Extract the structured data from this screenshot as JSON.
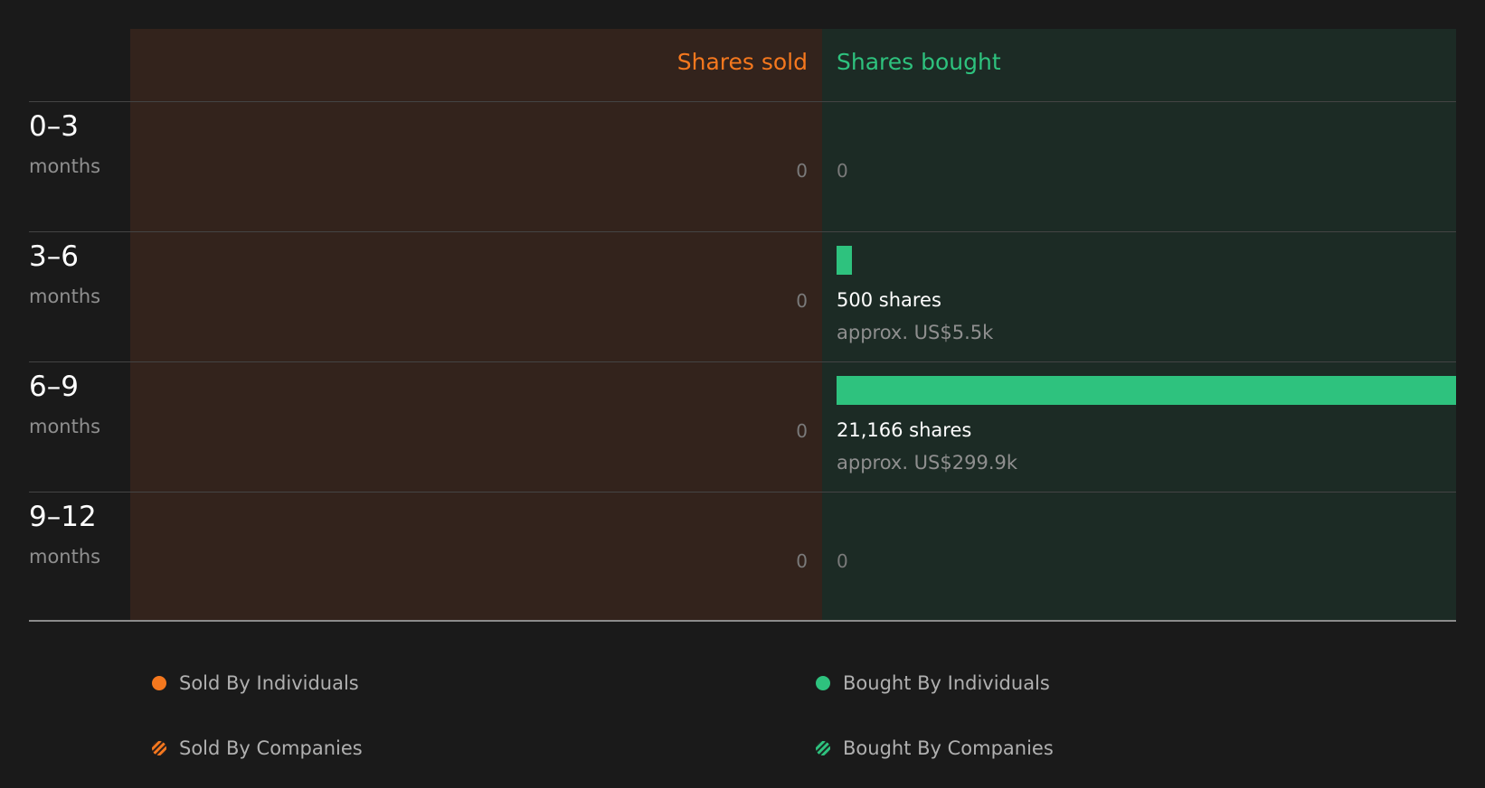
{
  "colors": {
    "sold": "#f5781e",
    "bought": "#2ec27e",
    "sold_panel": "#33231c",
    "bought_panel": "#1c2b25",
    "background": "#1a1a1a"
  },
  "headers": {
    "sold": "Shares sold",
    "bought": "Shares bought"
  },
  "chart_data": {
    "type": "bar",
    "categories": [
      "0–3 months",
      "3–6 months",
      "6–9 months",
      "9–12 months"
    ],
    "series": [
      {
        "name": "Shares sold",
        "values": [
          0,
          0,
          0,
          0
        ]
      },
      {
        "name": "Shares bought",
        "values": [
          0,
          500,
          21166,
          0
        ]
      }
    ],
    "max_value": 21166
  },
  "rows": [
    {
      "period": "0–3",
      "unit": "months",
      "sold_text": "0",
      "bought_zero_text": "0",
      "bought_shares": 0,
      "bought_shares_text": "",
      "bought_approx_text": ""
    },
    {
      "period": "3–6",
      "unit": "months",
      "sold_text": "0",
      "bought_zero_text": "",
      "bought_shares": 500,
      "bought_shares_text": "500 shares",
      "bought_approx_text": "approx. US$5.5k"
    },
    {
      "period": "6–9",
      "unit": "months",
      "sold_text": "0",
      "bought_zero_text": "",
      "bought_shares": 21166,
      "bought_shares_text": "21,166 shares",
      "bought_approx_text": "approx. US$299.9k"
    },
    {
      "period": "9–12",
      "unit": "months",
      "sold_text": "0",
      "bought_zero_text": "0",
      "bought_shares": 0,
      "bought_shares_text": "",
      "bought_approx_text": ""
    }
  ],
  "legend": {
    "sold_individuals": "Sold By Individuals",
    "sold_companies": "Sold By Companies",
    "bought_individuals": "Bought By Individuals",
    "bought_companies": "Bought By Companies"
  }
}
